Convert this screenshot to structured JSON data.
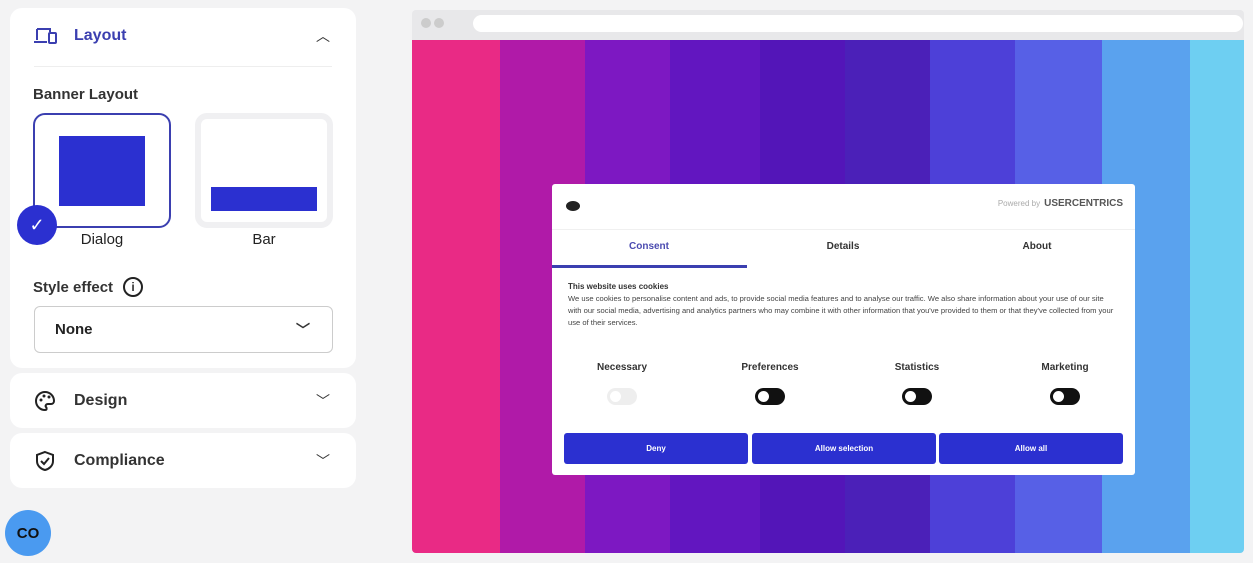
{
  "sidebar": {
    "layout": {
      "title": "Layout",
      "banner_layout_label": "Banner Layout",
      "options": [
        {
          "label": "Dialog",
          "selected": true
        },
        {
          "label": "Bar",
          "selected": false
        }
      ],
      "style_effect_label": "Style effect",
      "style_effect_value": "None"
    },
    "design": {
      "title": "Design"
    },
    "compliance": {
      "title": "Compliance"
    }
  },
  "colors": {
    "accent": "#2b30d0",
    "label_accent": "#3b3fb0"
  },
  "preview": {
    "powered_by": "Powered by",
    "brand": "USERCENTRICS",
    "tabs": [
      "Consent",
      "Details",
      "About"
    ],
    "heading": "This website uses cookies",
    "body": "We use cookies to personalise content and ads, to provide social media features and to analyse our traffic. We also share information about your use of our site with our social media, advertising and analytics partners who may combine it with other information that you've provided to them or that they've collected from your use of their services.",
    "categories": [
      {
        "label": "Necessary",
        "on": true,
        "disabled": true
      },
      {
        "label": "Preferences",
        "on": false
      },
      {
        "label": "Statistics",
        "on": false
      },
      {
        "label": "Marketing",
        "on": false
      }
    ],
    "buttons": [
      "Deny",
      "Allow selection",
      "Allow all"
    ]
  }
}
